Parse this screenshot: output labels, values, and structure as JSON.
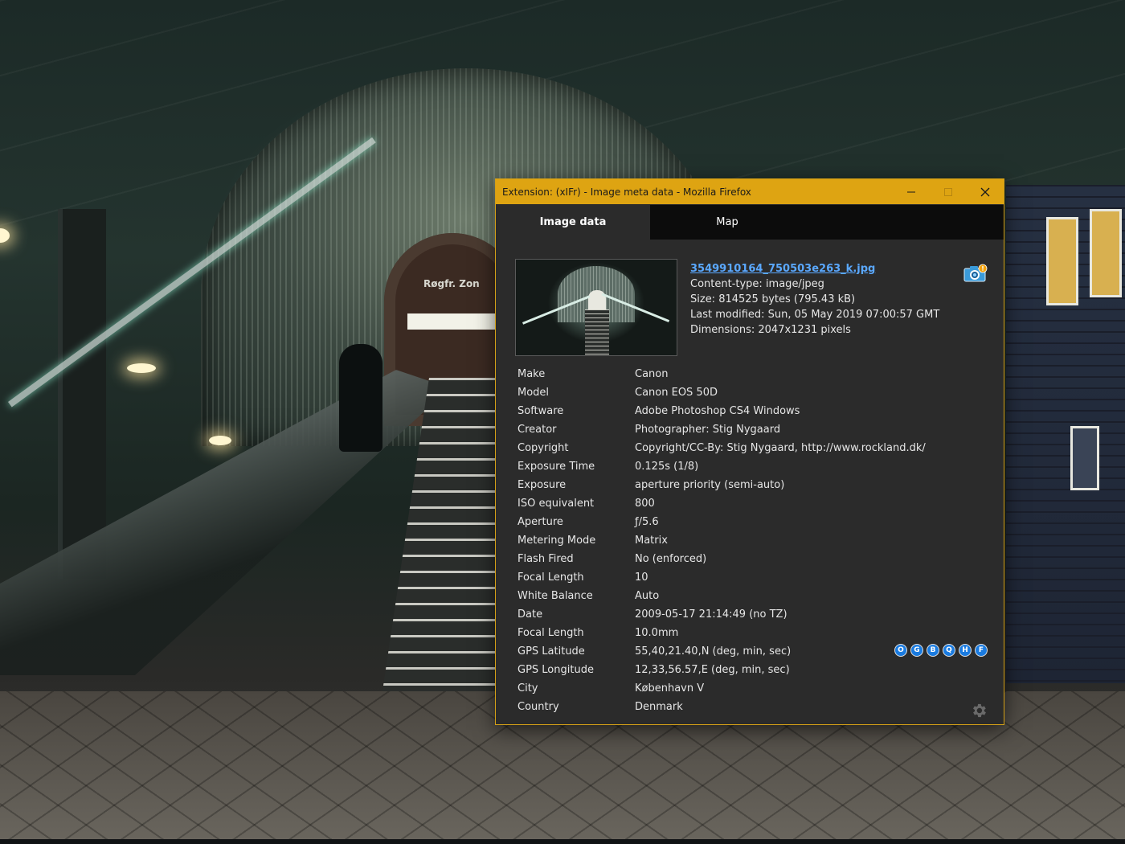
{
  "window": {
    "title": "Extension: (xIFr) - Image meta data - Mozilla Firefox",
    "minimize_icon": "minimize-icon",
    "maximize_icon": "maximize-icon",
    "close_icon": "close-icon",
    "titlebar_color": "#dea412",
    "background_color": "#2b2b2b"
  },
  "tabs": [
    {
      "label": "Image data",
      "active": true
    },
    {
      "label": "Map",
      "active": false
    }
  ],
  "file": {
    "name": "3549910164_750503e263_k.jpg",
    "content_type": "Content-type: image/jpeg",
    "size": "Size: 814525 bytes (795.43 kB)",
    "last_modified": "Last modified: Sun, 05 May 2019 07:00:57 GMT",
    "dimensions": "Dimensions: 2047x1231 pixels",
    "camera_icon": "camera-info-icon",
    "link_color": "#5aa8ff"
  },
  "metadata": [
    {
      "key": "Make",
      "value": "Canon"
    },
    {
      "key": "Model",
      "value": "Canon EOS 50D"
    },
    {
      "key": "Software",
      "value": "Adobe Photoshop CS4 Windows"
    },
    {
      "key": "Creator",
      "value": "Photographer: Stig Nygaard"
    },
    {
      "key": "Copyright",
      "value": "Copyright/CC-By: Stig Nygaard, http://www.rockland.dk/"
    },
    {
      "key": "Exposure Time",
      "value": "0.125s (1/8)"
    },
    {
      "key": "Exposure",
      "value": "aperture priority (semi-auto)"
    },
    {
      "key": "ISO equivalent",
      "value": "800"
    },
    {
      "key": "Aperture",
      "value": "ƒ/5.6"
    },
    {
      "key": "Metering Mode",
      "value": "Matrix"
    },
    {
      "key": "Flash Fired",
      "value": "No (enforced)"
    },
    {
      "key": "Focal Length",
      "value": "10"
    },
    {
      "key": "White Balance",
      "value": "Auto"
    },
    {
      "key": "Date",
      "value": "2009-05-17 21:14:49 (no TZ)"
    },
    {
      "key": "Focal Length",
      "value": "10.0mm"
    },
    {
      "key": "GPS Latitude",
      "value": "55,40,21.40,N (deg, min, sec)"
    },
    {
      "key": "GPS Longitude",
      "value": "12,33,56.57,E (deg, min, sec)"
    },
    {
      "key": "City",
      "value": "København V"
    },
    {
      "key": "Country",
      "value": "Denmark"
    }
  ],
  "map_links": [
    "O",
    "G",
    "B",
    "Q",
    "H",
    "F"
  ],
  "settings_icon": "gear-icon",
  "background_sign": "Røgfr. Zon"
}
